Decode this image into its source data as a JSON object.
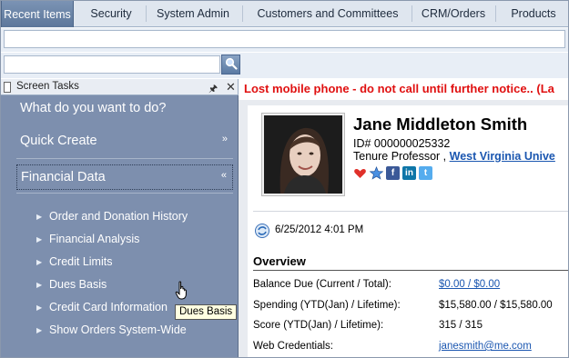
{
  "tabs": [
    {
      "label": "Recent Items",
      "active": true
    },
    {
      "label": "Security"
    },
    {
      "label": "System Admin"
    },
    {
      "label": "Customers and Committees"
    },
    {
      "label": "CRM/Orders"
    },
    {
      "label": "Products"
    }
  ],
  "search": {
    "placeholder": ""
  },
  "panel": {
    "title": "Screen Tasks",
    "prompt": "What do you want to do?",
    "sections": [
      {
        "label": "Quick Create",
        "state": "collapsed"
      },
      {
        "label": "Financial Data",
        "state": "expanded"
      }
    ],
    "items": [
      "Order and Donation History",
      "Financial Analysis",
      "Credit Limits",
      "Dues Basis",
      "Credit Card Information",
      "Show Orders System-Wide"
    ],
    "tooltip": "Dues Basis"
  },
  "alert": "Lost mobile phone - do not call until further notice.. (La",
  "profile": {
    "name": "Jane Middleton Smith",
    "id_line": "ID# 000000025332",
    "title": "Tenure Professor ,",
    "org": "West Virginia Unive",
    "date": "6/25/2012 4:01 PM"
  },
  "overview": {
    "heading": "Overview",
    "rows": [
      {
        "label": "Balance Due (Current / Total):",
        "value": "$0.00 / $0.00",
        "link": true
      },
      {
        "label": "Spending (YTD(Jan) / Lifetime):",
        "value": "$15,580.00 / $15,580.00"
      },
      {
        "label": "Score (YTD(Jan) / Lifetime):",
        "value": "315 / 315"
      },
      {
        "label": "Web Credentials:",
        "value": "janesmith@me.com",
        "link": true
      }
    ]
  },
  "colors": {
    "alert": "#e01010",
    "panel": "#7d8fae",
    "link": "#1a56b0"
  }
}
